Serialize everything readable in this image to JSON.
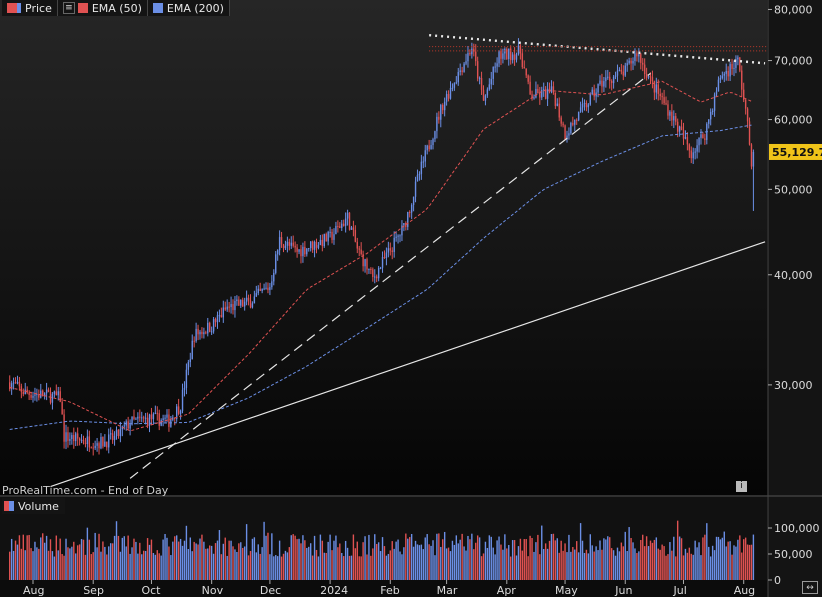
{
  "legend": {
    "price_label": "Price",
    "ema50_label": "EMA (50)",
    "ema200_label": "EMA (200)"
  },
  "volume_label": "Volume",
  "watermark": "ProRealTime.com - End of Day",
  "last_price_label": "55,129.70",
  "colors": {
    "up": "#6b8fe6",
    "down": "#e05252",
    "ema50": "#e05252",
    "ema200": "#6b8fe6",
    "background": "#0c0c0c",
    "last_price_bg": "#f0c419"
  },
  "icons": {
    "info": "info-icon",
    "corner": "expand-icon"
  },
  "chart_data": {
    "type": "candlestick",
    "ylabel_ticks": [
      "80,000",
      "70,000",
      "60,000",
      "50,000",
      "40,000",
      "30,000"
    ],
    "y_tick_values": [
      80000,
      70000,
      60000,
      50000,
      40000,
      30000
    ],
    "x_tick_labels": [
      "Aug",
      "Sep",
      "Oct",
      "Nov",
      "Dec",
      "2024",
      "Feb",
      "Mar",
      "Apr",
      "May",
      "Jun",
      "Jul",
      "Aug"
    ],
    "x_tick_dates": [
      "2023-08-01",
      "2023-09-01",
      "2023-10-01",
      "2023-11-01",
      "2023-12-01",
      "2024-01-01",
      "2024-02-01",
      "2024-03-01",
      "2024-04-01",
      "2024-05-01",
      "2024-06-01",
      "2024-07-01",
      "2024-08-01"
    ],
    "y_scale": "log",
    "ylim": [
      22500,
      82000
    ],
    "last_price": 55129.7,
    "price_path": [
      [
        "2023-07-20",
        30200
      ],
      [
        "2023-07-28",
        29400
      ],
      [
        "2023-08-08",
        29200
      ],
      [
        "2023-08-15",
        29000
      ],
      [
        "2023-08-17",
        26200
      ],
      [
        "2023-08-25",
        26000
      ],
      [
        "2023-09-05",
        25800
      ],
      [
        "2023-09-12",
        26100
      ],
      [
        "2023-09-20",
        27200
      ],
      [
        "2023-10-01",
        27500
      ],
      [
        "2023-10-10",
        27300
      ],
      [
        "2023-10-16",
        28500
      ],
      [
        "2023-10-23",
        34200
      ],
      [
        "2023-11-01",
        35000
      ],
      [
        "2023-11-09",
        36700
      ],
      [
        "2023-11-20",
        37200
      ],
      [
        "2023-12-01",
        38800
      ],
      [
        "2023-12-06",
        43800
      ],
      [
        "2023-12-15",
        42500
      ],
      [
        "2024-01-01",
        44100
      ],
      [
        "2024-01-10",
        46500
      ],
      [
        "2024-01-15",
        42800
      ],
      [
        "2024-01-23",
        39600
      ],
      [
        "2024-02-01",
        42700
      ],
      [
        "2024-02-08",
        45300
      ],
      [
        "2024-02-16",
        52100
      ],
      [
        "2024-02-28",
        62500
      ],
      [
        "2024-03-05",
        66400
      ],
      [
        "2024-03-14",
        72500
      ],
      [
        "2024-03-20",
        62900
      ],
      [
        "2024-03-28",
        70800
      ],
      [
        "2024-04-08",
        71600
      ],
      [
        "2024-04-13",
        63800
      ],
      [
        "2024-04-25",
        64400
      ],
      [
        "2024-05-01",
        57800
      ],
      [
        "2024-05-10",
        61500
      ],
      [
        "2024-05-20",
        66200
      ],
      [
        "2024-06-01",
        68000
      ],
      [
        "2024-06-07",
        71600
      ],
      [
        "2024-06-14",
        66300
      ],
      [
        "2024-06-24",
        61200
      ],
      [
        "2024-07-05",
        55000
      ],
      [
        "2024-07-12",
        57900
      ],
      [
        "2024-07-20",
        67100
      ],
      [
        "2024-07-29",
        69900
      ],
      [
        "2024-08-02",
        61400
      ],
      [
        "2024-08-05",
        54000
      ],
      [
        "2024-08-06",
        55129.7
      ]
    ],
    "ema50_path": [
      [
        "2023-07-20",
        29800
      ],
      [
        "2023-08-20",
        28700
      ],
      [
        "2023-09-20",
        26600
      ],
      [
        "2023-10-20",
        27800
      ],
      [
        "2023-11-20",
        32500
      ],
      [
        "2023-12-20",
        38500
      ],
      [
        "2024-01-20",
        42300
      ],
      [
        "2024-02-20",
        47500
      ],
      [
        "2024-03-20",
        58500
      ],
      [
        "2024-04-20",
        64800
      ],
      [
        "2024-05-20",
        64000
      ],
      [
        "2024-06-20",
        66300
      ],
      [
        "2024-07-10",
        62800
      ],
      [
        "2024-07-25",
        64500
      ],
      [
        "2024-08-06",
        62800
      ]
    ],
    "ema200_path": [
      [
        "2023-07-20",
        26700
      ],
      [
        "2023-08-20",
        27300
      ],
      [
        "2023-09-20",
        27100
      ],
      [
        "2023-10-20",
        27200
      ],
      [
        "2023-11-20",
        29000
      ],
      [
        "2023-12-20",
        31500
      ],
      [
        "2024-01-20",
        34800
      ],
      [
        "2024-02-20",
        38500
      ],
      [
        "2024-03-20",
        44000
      ],
      [
        "2024-04-20",
        50000
      ],
      [
        "2024-05-20",
        53800
      ],
      [
        "2024-06-20",
        57500
      ],
      [
        "2024-07-20",
        58300
      ],
      [
        "2024-08-06",
        59200
      ]
    ],
    "trendlines": [
      {
        "style": "solid",
        "from": [
          "2023-08-10",
          23000
        ],
        "to": [
          "2024-08-12",
          43600
        ]
      },
      {
        "style": "dashed",
        "from": [
          "2023-09-20",
          23500
        ],
        "to": [
          "2024-06-14",
          67700
        ]
      },
      {
        "style": "dotted",
        "from": [
          "2024-02-21",
          74800
        ],
        "to": [
          "2024-08-12",
          69500
        ]
      }
    ],
    "resistance_dotted": [
      72600,
      71800
    ],
    "volume_ticks": [
      "100,000",
      "50,000",
      "0"
    ],
    "volume_tick_values": [
      100000,
      50000,
      0
    ],
    "volume_range": [
      0,
      125000
    ]
  }
}
